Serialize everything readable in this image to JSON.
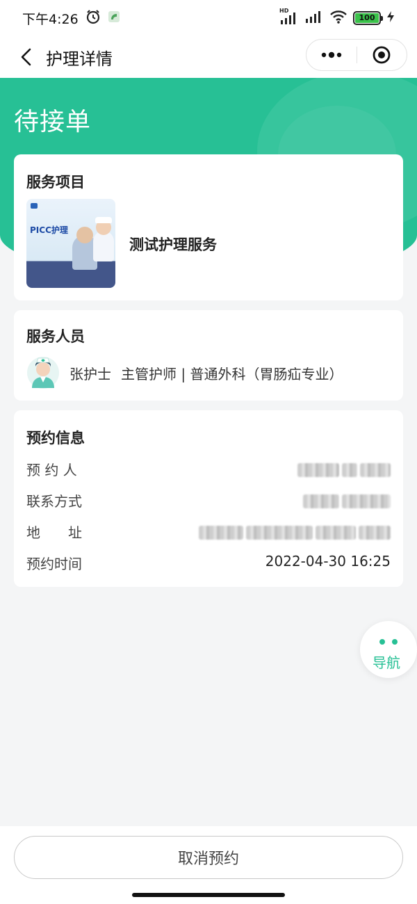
{
  "status_bar": {
    "time": "下午4:26",
    "battery": "100",
    "network_badge": "HD",
    "icons": [
      "alarm-icon",
      "app-notification-icon",
      "signal-icon",
      "wifi-icon",
      "battery-icon",
      "charging-icon"
    ]
  },
  "nav": {
    "title": "护理详情",
    "back_icon": "chevron-left-icon",
    "more_icon": "more-dots-icon",
    "close_icon": "target-close-icon"
  },
  "hero": {
    "status": "待接单",
    "color": "#27c095"
  },
  "service": {
    "section_title": "服务项目",
    "name": "测试护理服务",
    "thumbnail": {
      "headline": "PICC护理"
    }
  },
  "staff": {
    "section_title": "服务人员",
    "name": "张护士",
    "title": "主管护师",
    "department": "普通外科（胃肠疝专业）"
  },
  "booking": {
    "section_title": "预约信息",
    "rows": [
      {
        "label": "预 约 人",
        "value": ""
      },
      {
        "label": "联系方式",
        "value": ""
      },
      {
        "label": "地　　址",
        "value": ""
      },
      {
        "label": "预约时间",
        "value": "2022-04-30 16:25"
      }
    ]
  },
  "floating_nav": {
    "label": "导航"
  },
  "actions": {
    "cancel_label": "取消预约"
  },
  "colors": {
    "accent": "#27c095",
    "background": "#f4f5f6"
  }
}
